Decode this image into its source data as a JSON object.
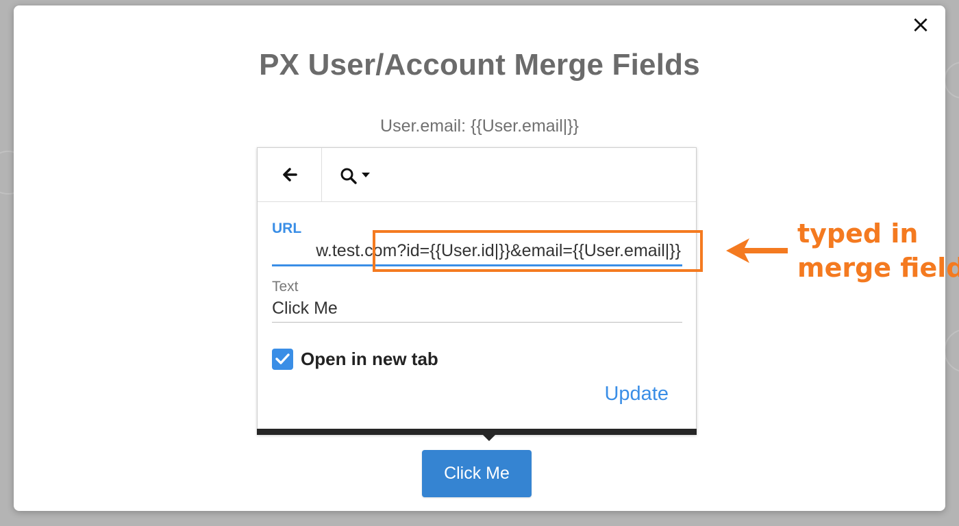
{
  "modal": {
    "close_label": "×",
    "title": "PX User/Account Merge Fields",
    "merge_line": "User.email: {{User.email|}}"
  },
  "link_editor": {
    "toolbar": {
      "back_icon": "arrow-left-icon",
      "search_icon": "search-icon",
      "dropdown_icon": "caret-down-icon"
    },
    "url": {
      "label": "URL",
      "value": "w.test.com?id={{User.id|}}&email={{User.email|}}"
    },
    "text": {
      "label": "Text",
      "value": "Click Me"
    },
    "open_in_new_tab": {
      "label": "Open in new tab",
      "checked": true
    },
    "update_label": "Update"
  },
  "button": {
    "label": "Click Me"
  },
  "annotation": {
    "line1": "typed in",
    "line2": "merge fields"
  },
  "colors": {
    "accent": "#3a8ee6",
    "button": "#3584d2",
    "annotation": "#f47a20"
  }
}
